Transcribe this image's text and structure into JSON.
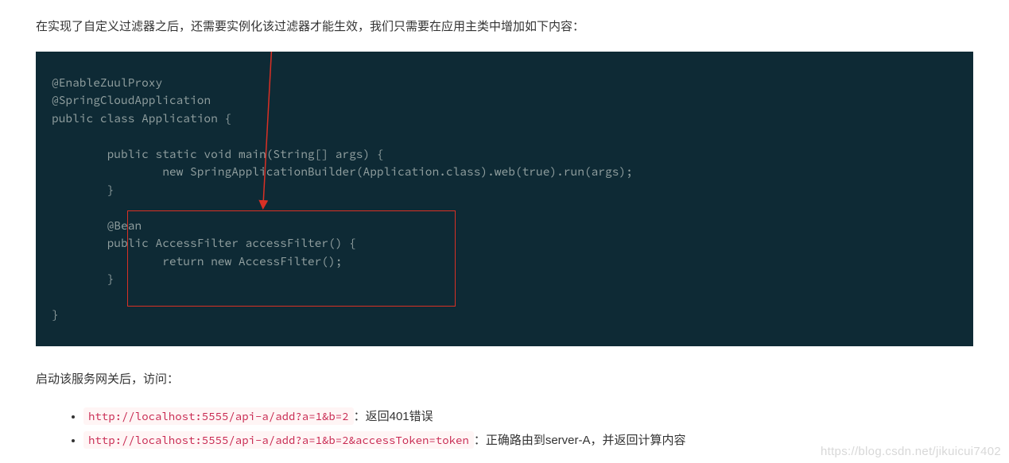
{
  "intro": "在实现了自定义过滤器之后，还需要实例化该过滤器才能生效，我们只需要在应用主类中增加如下内容：",
  "code": {
    "line1": "@EnableZuulProxy",
    "line2": "@SpringCloudApplication",
    "line3": "public class Application {",
    "line4": "",
    "line5": "        public static void main(String[] args) {",
    "line6": "                new SpringApplicationBuilder(Application.class).web(true).run(args);",
    "line7": "        }",
    "line8": "",
    "line9": "        @Bean",
    "line10": "        public AccessFilter accessFilter() {",
    "line11": "                return new AccessFilter();",
    "line12": "        }",
    "line13": "",
    "line14": "}"
  },
  "post_text": "启动该服务网关后，访问：",
  "list": [
    {
      "url": "http://localhost:5555/api-a/add?a=1&b=2",
      "desc": "：返回401错误"
    },
    {
      "url": "http://localhost:5555/api-a/add?a=1&b=2&accessToken=token",
      "desc": "：正确路由到server-A，并返回计算内容"
    }
  ],
  "watermark": "https://blog.csdn.net/jikuicui7402"
}
